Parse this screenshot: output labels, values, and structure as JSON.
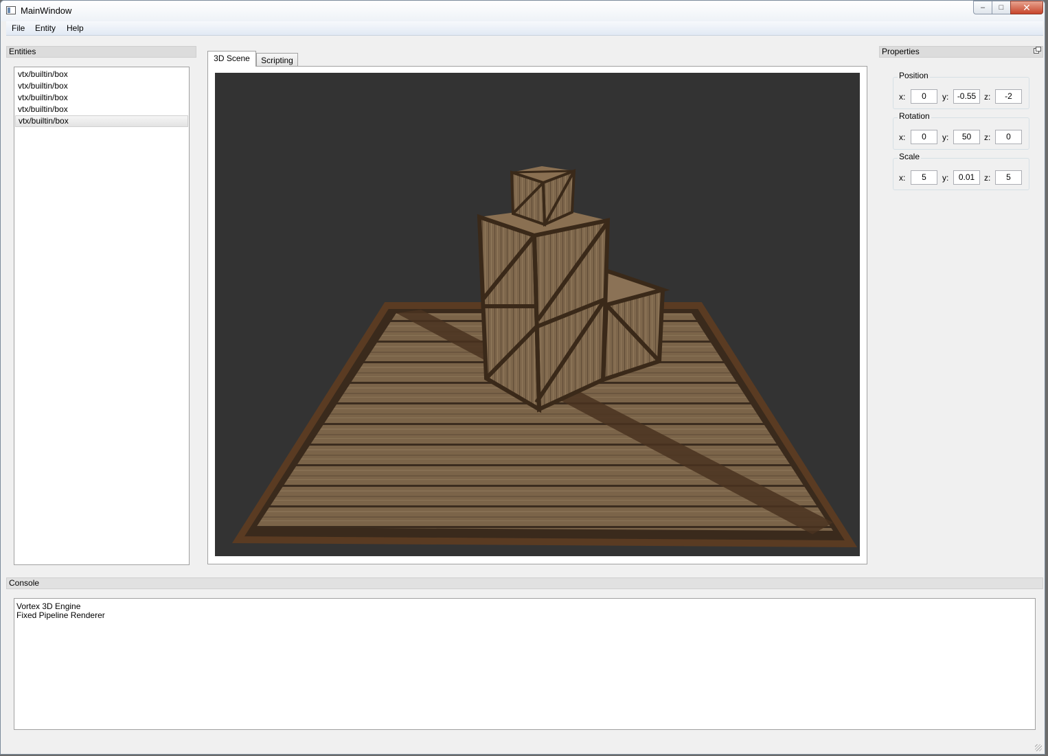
{
  "window": {
    "title": "MainWindow",
    "minimize_glyph": "–",
    "maximize_glyph": "□",
    "close_glyph": "✕"
  },
  "menubar": {
    "file": "File",
    "entity": "Entity",
    "help": "Help"
  },
  "entities_panel": {
    "title": "Entities",
    "items": [
      {
        "label": "vtx/builtin/box",
        "selected": false
      },
      {
        "label": "vtx/builtin/box",
        "selected": false
      },
      {
        "label": "vtx/builtin/box",
        "selected": false
      },
      {
        "label": "vtx/builtin/box",
        "selected": false
      },
      {
        "label": "vtx/builtin/box",
        "selected": true
      }
    ]
  },
  "tabs": {
    "scene": "3D Scene",
    "scripting": "Scripting",
    "active": "3D Scene"
  },
  "viewport": {
    "background": "#333333"
  },
  "properties": {
    "title": "Properties",
    "position": {
      "label": "Position",
      "x_label": "x:",
      "y_label": "y:",
      "z_label": "z:",
      "x": "0",
      "y": "-0.55",
      "z": "-2"
    },
    "rotation": {
      "label": "Rotation",
      "x_label": "x:",
      "y_label": "y:",
      "z_label": "z:",
      "x": "0",
      "y": "50",
      "z": "0"
    },
    "scale": {
      "label": "Scale",
      "x_label": "x:",
      "y_label": "y:",
      "z_label": "z:",
      "x": "5",
      "y": "0.01",
      "z": "5"
    }
  },
  "console": {
    "title": "Console",
    "lines": [
      "Vortex 3D Engine",
      "Fixed Pipeline Renderer"
    ]
  }
}
